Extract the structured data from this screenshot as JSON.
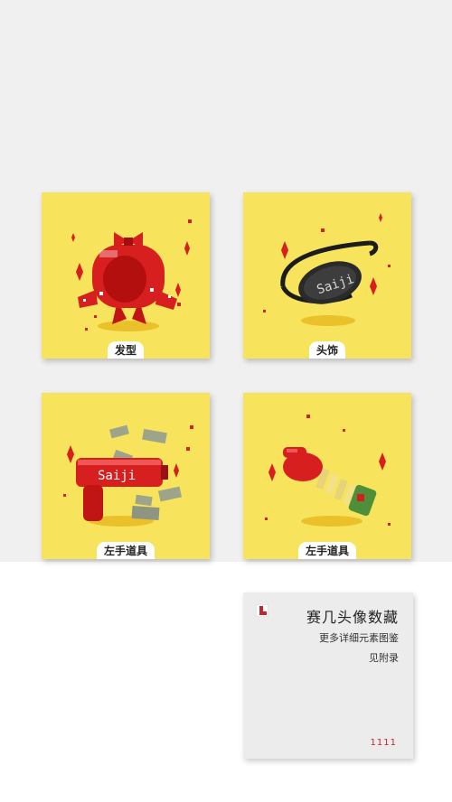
{
  "cards": [
    {
      "label": "发型",
      "art_name": "red-bow-hair-pixel-art"
    },
    {
      "label": "头饰",
      "art_name": "saiji-eyepatch-pixel-art"
    },
    {
      "label": "左手道具",
      "art_name": "saiji-money-gun-pixel-art"
    },
    {
      "label": "左手道具",
      "art_name": "boxing-glove-spring-pixel-art"
    }
  ],
  "info": {
    "title": "赛几头像数藏",
    "line1": "更多详细元素图鉴",
    "line2": "见附录",
    "page_number": "1111"
  },
  "art_text": {
    "brand": "Saiji"
  },
  "colors": {
    "card_background": "#f7e35c",
    "page_top": "#f0f0f0",
    "accent_red": "#c0262d"
  }
}
